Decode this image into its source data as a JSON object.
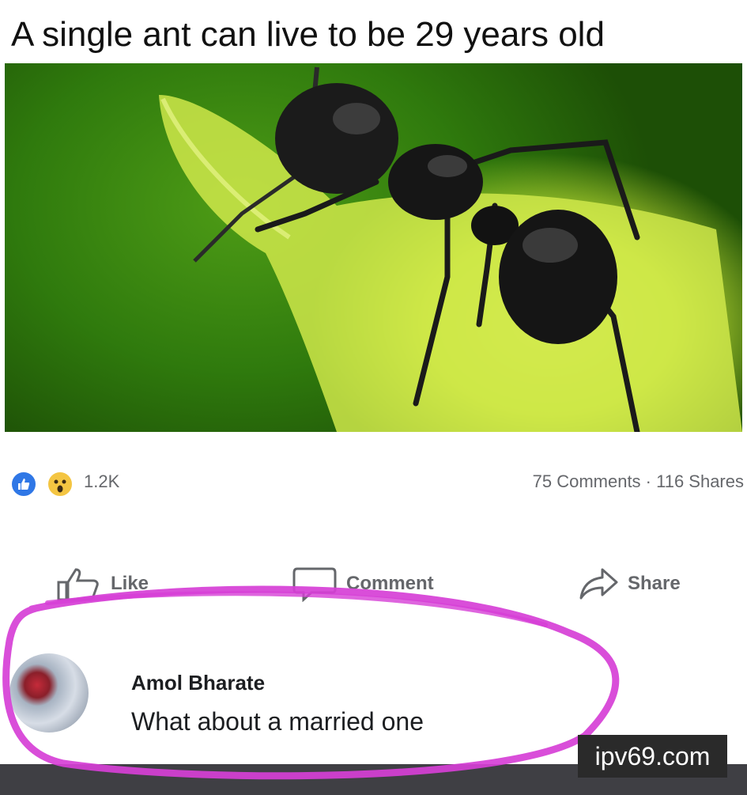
{
  "post": {
    "title": "A single ant can live to be 29 years old"
  },
  "reactions": {
    "count": "1.2K",
    "comments_shares": "75 Comments · 116 Shares",
    "icons": [
      "like-icon",
      "wow-icon"
    ]
  },
  "actions": {
    "like": "Like",
    "comment": "Comment",
    "share": "Share"
  },
  "comment": {
    "author": "Amol Bharate",
    "text": "What about a married one"
  },
  "watermark": {
    "text": "ipv69.com"
  },
  "colors": {
    "like_blue": "#2f77e6",
    "wow_yellow": "#f4c542",
    "highlight_magenta": "#d63fd6",
    "secondary_text": "#65676b"
  }
}
